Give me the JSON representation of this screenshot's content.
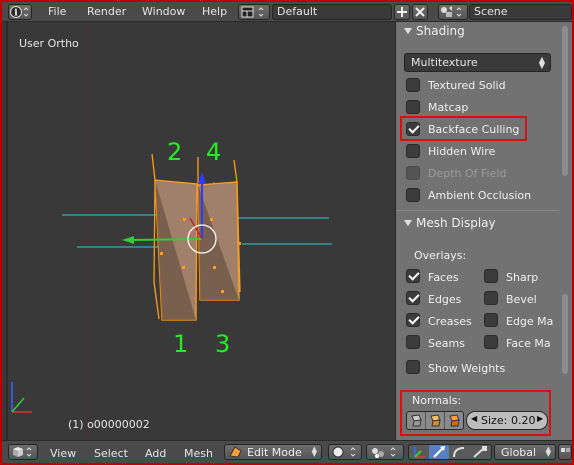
{
  "top_header": {
    "editor_icon": "info-icon",
    "menus": [
      "File",
      "Render",
      "Window",
      "Help"
    ],
    "layout_icon": "screen-layout-icon",
    "layout_name": "Default",
    "add_icon": "plus-icon",
    "close_icon": "close-icon",
    "scene_icon": "scene-icon",
    "scene_name": "Scene"
  },
  "viewport": {
    "view_label": "User Ortho",
    "status": "(1) o00000002",
    "annotations": [
      "2",
      "4",
      "1",
      "3"
    ],
    "annotation_color": "#22ee22"
  },
  "properties": {
    "shading": {
      "title": "Shading",
      "mode": "Multitexture",
      "options": [
        {
          "label": "Textured Solid",
          "checked": false,
          "enabled": true
        },
        {
          "label": "Matcap",
          "checked": false,
          "enabled": true
        },
        {
          "label": "Backface Culling",
          "checked": true,
          "enabled": true
        },
        {
          "label": "Hidden Wire",
          "checked": false,
          "enabled": true
        },
        {
          "label": "Depth Of Field",
          "checked": false,
          "enabled": false
        },
        {
          "label": "Ambient Occlusion",
          "checked": false,
          "enabled": true
        }
      ]
    },
    "mesh_display": {
      "title": "Mesh Display",
      "overlays_label": "Overlays:",
      "overlays_left": [
        {
          "label": "Faces",
          "checked": true
        },
        {
          "label": "Edges",
          "checked": true
        },
        {
          "label": "Creases",
          "checked": true
        },
        {
          "label": "Seams",
          "checked": false
        }
      ],
      "overlays_right": [
        {
          "label": "Sharp",
          "checked": false
        },
        {
          "label": "Bevel",
          "checked": false
        },
        {
          "label": "Edge Ma",
          "checked": false
        },
        {
          "label": "Face Ma",
          "checked": false
        }
      ],
      "show_weights": {
        "label": "Show Weights",
        "checked": false
      },
      "normals_label": "Normals:",
      "normal_icons": [
        "vertex-normal-icon",
        "split-normal-icon",
        "face-normal-icon"
      ],
      "size_label": "Size:",
      "size_value": "0.20"
    }
  },
  "bottom_header": {
    "editor_icon": "3d-view-icon",
    "menus": [
      "View",
      "Select",
      "Add",
      "Mesh"
    ],
    "mode_icon": "edit-mode-icon",
    "mode": "Edit Mode",
    "shading_icon": "viewport-shading-icon",
    "pivot_icon": "pivot-point-icon",
    "manipulator_icons": [
      "manipulator-toggle-icon",
      "translate-icon",
      "rotate-icon",
      "scale-icon"
    ],
    "orientation": "Global",
    "layers_icon": "layers-icon"
  },
  "colors": {
    "highlight": "#d91010",
    "mesh_edge": "#ff9c1a",
    "face": "#a0806a",
    "normal_line": "#33cccc"
  }
}
